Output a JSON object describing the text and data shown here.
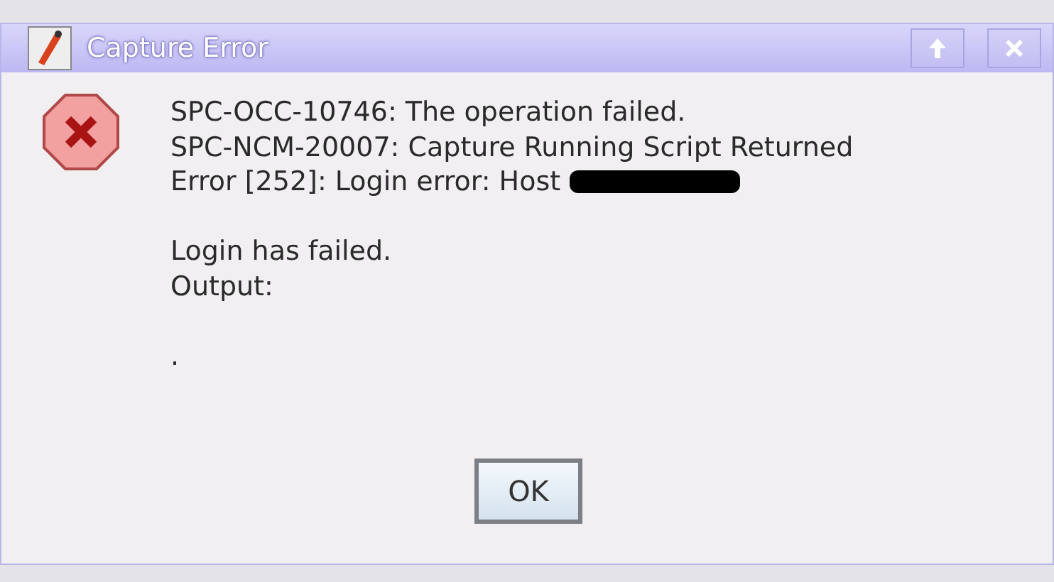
{
  "window": {
    "title": "Capture Error"
  },
  "message": {
    "paragraphs": [
      {
        "lines": [
          {
            "text": "SPC-OCC-10746: The operation failed.",
            "redacted": false
          },
          {
            "text": "SPC-NCM-20007: Capture Running Script Returned",
            "redacted": false
          },
          {
            "text": "Error [252]: Login error: Host",
            "redacted": true
          }
        ]
      },
      {
        "lines": [
          {
            "text": "Login has failed.",
            "redacted": false
          },
          {
            "text": "Output:",
            "redacted": false
          }
        ]
      },
      {
        "lines": [
          {
            "text": ".",
            "redacted": false
          }
        ]
      }
    ]
  },
  "buttons": [
    "OK"
  ]
}
